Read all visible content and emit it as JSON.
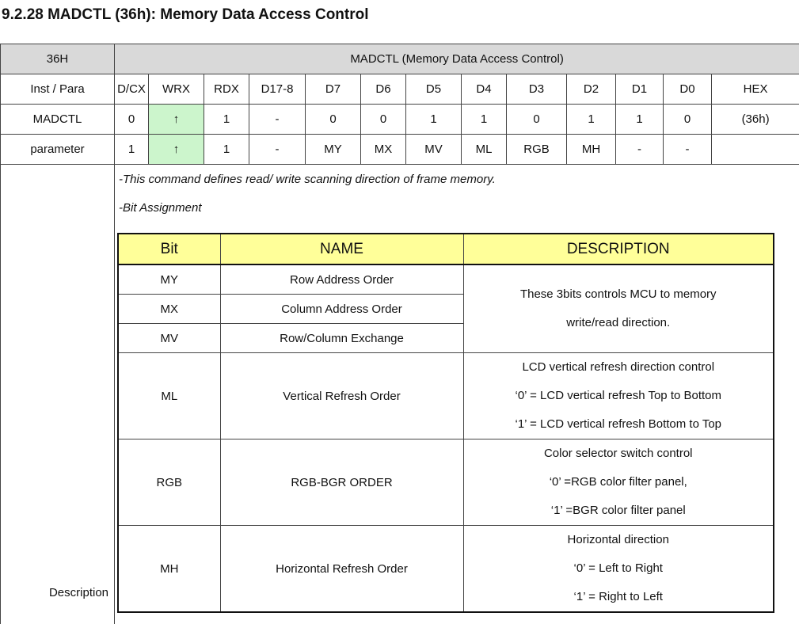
{
  "heading": "9.2.28 MADCTL (36h): Memory Data Access Control",
  "register": {
    "code": "36H",
    "title": "MADCTL (Memory Data Access Control)",
    "columns": [
      "Inst / Para",
      "D/CX",
      "WRX",
      "RDX",
      "D17-8",
      "D7",
      "D6",
      "D5",
      "D4",
      "D3",
      "D2",
      "D1",
      "D0",
      "HEX"
    ],
    "rows": [
      [
        "MADCTL",
        "0",
        "↑",
        "1",
        "-",
        "0",
        "0",
        "1",
        "1",
        "0",
        "1",
        "1",
        "0",
        "(36h)"
      ],
      [
        "parameter",
        "1",
        "↑",
        "1",
        "-",
        "MY",
        "MX",
        "MV",
        "ML",
        "RGB",
        "MH",
        "-",
        "-",
        ""
      ]
    ]
  },
  "description": {
    "label": "Description",
    "line1": "-This command defines read/ write scanning direction of frame memory.",
    "line2": "-Bit Assignment"
  },
  "bit_table": {
    "headers": [
      "Bit",
      "NAME",
      "DESCRIPTION"
    ],
    "rows": [
      {
        "bit": "MY",
        "name": "Row Address Order"
      },
      {
        "bit": "MX",
        "name": "Column Address Order"
      },
      {
        "bit": "MV",
        "name": "Row/Column Exchange"
      },
      {
        "bit": "ML",
        "name": "Vertical Refresh Order"
      },
      {
        "bit": "RGB",
        "name": "RGB-BGR ORDER"
      },
      {
        "bit": "MH",
        "name": "Horizontal Refresh Order"
      }
    ],
    "desc_group1": [
      "These 3bits controls MCU to memory",
      "write/read direction."
    ],
    "desc_ml": [
      "LCD vertical refresh direction control",
      "‘0’ = LCD vertical refresh Top to Bottom",
      "‘1’ = LCD vertical refresh Bottom to Top"
    ],
    "desc_rgb": [
      "Color selector switch control",
      "‘0’ =RGB color filter panel,",
      "‘1’ =BGR color filter panel"
    ],
    "desc_mh": [
      "Horizontal direction",
      "‘0’ = Left to Right",
      "‘1’ = Right to Left"
    ]
  },
  "colors": {
    "header_gray": "#d9d9d9",
    "wrx_green": "#ccf5cc",
    "bit_header_yellow": "#ffff99"
  }
}
